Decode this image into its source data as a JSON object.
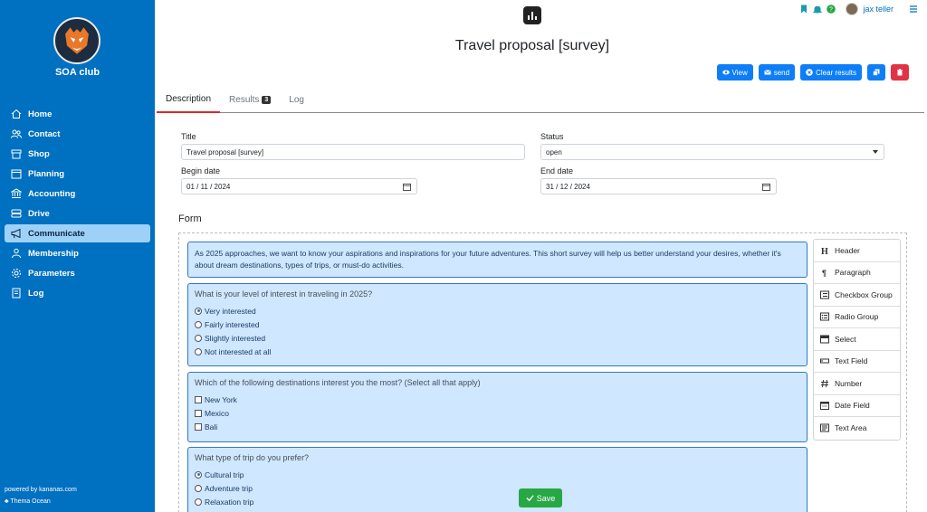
{
  "sidebar": {
    "club_name": "SOA club",
    "items": [
      {
        "label": "Home",
        "icon": "home-icon"
      },
      {
        "label": "Contact",
        "icon": "people-icon"
      },
      {
        "label": "Shop",
        "icon": "shop-icon"
      },
      {
        "label": "Planning",
        "icon": "calendar-icon"
      },
      {
        "label": "Accounting",
        "icon": "bank-icon"
      },
      {
        "label": "Drive",
        "icon": "drive-icon"
      },
      {
        "label": "Communicate",
        "icon": "megaphone-icon",
        "active": true
      },
      {
        "label": "Membership",
        "icon": "person-icon"
      },
      {
        "label": "Parameters",
        "icon": "gear-icon"
      },
      {
        "label": "Log",
        "icon": "journal-icon"
      }
    ],
    "powered_by": "powered by kananas.com",
    "theme": "Thema Ocean"
  },
  "topbar": {
    "user_name": "jax teller",
    "help_badge": "?"
  },
  "page": {
    "title": "Travel proposal [survey]"
  },
  "actions": {
    "view": "View",
    "send": "send",
    "clear": "Clear results"
  },
  "tabs": {
    "description": "Description",
    "results": "Results",
    "results_count": "3",
    "log": "Log"
  },
  "form_fields": {
    "title_label": "Title",
    "title_value": "Travel proposal [survey]",
    "status_label": "Status",
    "status_value": "open",
    "begin_label": "Begin date",
    "begin_value": "01 / 11 / 2024",
    "end_label": "End date",
    "end_value": "31 / 12 / 2024"
  },
  "builder": {
    "heading": "Form",
    "intro": "As 2025 approaches, we want to know your aspirations and inspirations for your future adventures. This short survey will help us better understand your desires, whether it's about dream destinations, types of trips, or must-do activities.",
    "q1": {
      "question": "What is your level of interest in traveling in 2025?",
      "options": [
        "Very interested",
        "Fairly interested",
        "Slightly interested",
        "Not interested at all"
      ]
    },
    "q2": {
      "question": "Which of the following destinations interest you the most? (Select all that apply)",
      "options": [
        "New York",
        "Mexico",
        "Bali"
      ]
    },
    "q3": {
      "question": "What type of trip do you prefer?",
      "options": [
        "Cultural trip",
        "Adventure trip",
        "Relaxation trip"
      ]
    }
  },
  "palette": [
    "Header",
    "Paragraph",
    "Checkbox Group",
    "Radio Group",
    "Select",
    "Text Field",
    "Number",
    "Date Field",
    "Text Area"
  ],
  "save_label": "Save"
}
